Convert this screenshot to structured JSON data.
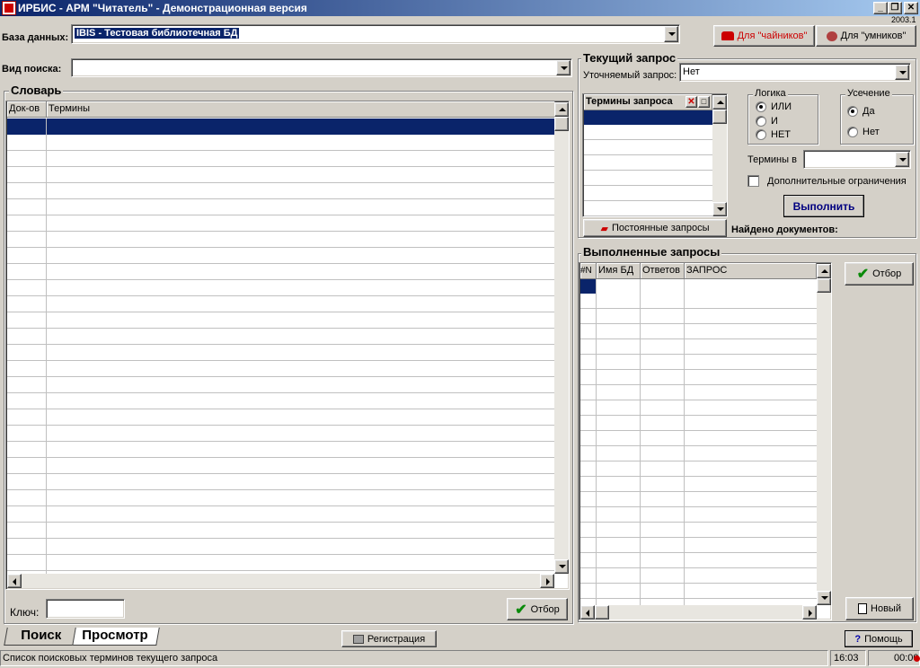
{
  "titlebar": {
    "title": "ИРБИС - АРМ \"Читатель\" - Демонстрационная версия",
    "version": "2003.1"
  },
  "db": {
    "label": "База данных:",
    "value": "IBIS - Тестовая библиотечная БД"
  },
  "buttons": {
    "dummies": "Для \"чайников\"",
    "smart": "Для \"умников\""
  },
  "search_type": {
    "label": "Вид поиска:",
    "value": ""
  },
  "dictionary": {
    "title": "Словарь",
    "col_docs": "Док-ов",
    "col_terms": "Термины"
  },
  "key": {
    "label": "Ключ:",
    "value": ""
  },
  "select_btn": "Отбор",
  "current_query": {
    "title": "Текущий запрос",
    "refine_label": "Уточняемый запрос:",
    "refine_value": "Нет",
    "terms_header": "Термины запроса",
    "logic": {
      "title": "Логика",
      "options": [
        "ИЛИ",
        "И",
        "НЕТ"
      ],
      "selected": 0
    },
    "trunc": {
      "title": "Усечение",
      "options": [
        "Да",
        "Нет"
      ],
      "selected": 0
    },
    "terms_in_label": "Термины в",
    "terms_in_value": "",
    "extra_label": "Дополнительные ограничения",
    "run_btn": "Выполнить",
    "saved_btn": "Постоянные запросы",
    "found_label": "Найдено документов:"
  },
  "executed": {
    "title": "Выполненные запросы",
    "cols": [
      "#N",
      "Имя БД",
      "Ответов",
      "ЗАПРОС"
    ],
    "select_btn": "Отбор",
    "new_btn": "Новый"
  },
  "tabs": [
    "Поиск",
    "Просмотр"
  ],
  "reg_btn": "Регистрация",
  "help_btn": "Помощь",
  "status": {
    "text": "Список поисковых терминов текущего запроса",
    "time": "16:03",
    "timer": "00:00"
  },
  "colors": {
    "title_start": "#0a246a",
    "title_end": "#a6caf0",
    "selection": "#0a246a",
    "red": "#cc0000"
  }
}
